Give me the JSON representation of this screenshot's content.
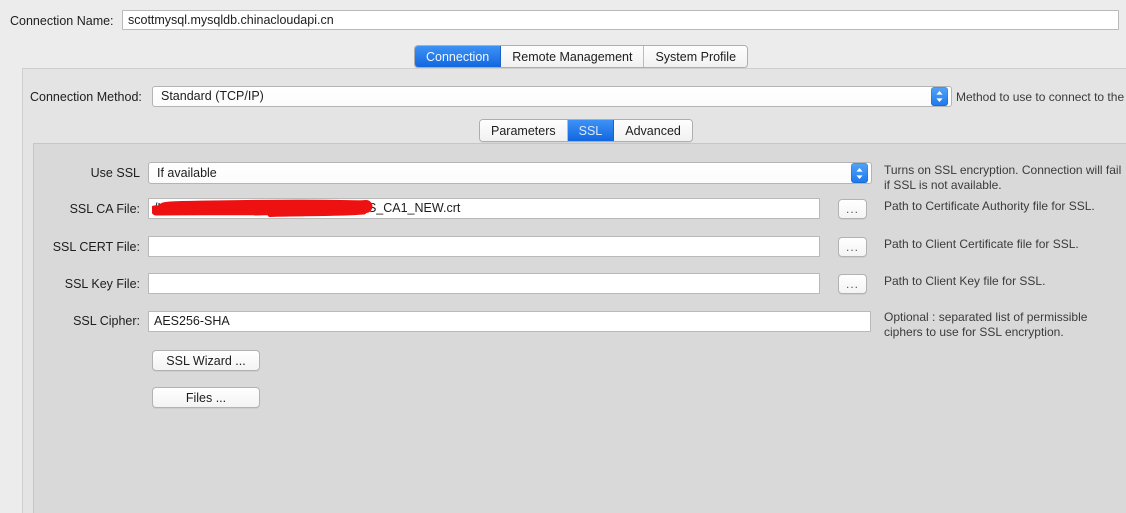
{
  "connection_name": {
    "label": "Connection Name:",
    "value": "scottmysql.mysqldb.chinacloudapi.cn"
  },
  "main_tabs": [
    {
      "label": "Connection",
      "selected": true
    },
    {
      "label": "Remote Management",
      "selected": false
    },
    {
      "label": "System Profile",
      "selected": false
    }
  ],
  "connection_method": {
    "label": "Connection Method:",
    "value": "Standard (TCP/IP)",
    "help": "Method to use to connect to the RD"
  },
  "sub_tabs": [
    {
      "label": "Parameters",
      "selected": false
    },
    {
      "label": "SSL",
      "selected": true
    },
    {
      "label": "Advanced",
      "selected": false
    }
  ],
  "ssl_form": {
    "use_ssl": {
      "label": "Use SSL",
      "value": "If available",
      "help": "Turns on SSL encryption. Connection will fail if SSL is not available."
    },
    "ca_file": {
      "label": "SSL CA File:",
      "value": "/Users/scottxiao/Documents/              /Azure/WS_CA1_NEW.crt",
      "browse_label": "...",
      "help": "Path to Certificate Authority file for SSL."
    },
    "cert_file": {
      "label": "SSL CERT File:",
      "value": "",
      "browse_label": "...",
      "help": "Path to Client Certificate file for SSL."
    },
    "key_file": {
      "label": "SSL Key File:",
      "value": "",
      "browse_label": "...",
      "help": "Path to Client Key file for SSL."
    },
    "cipher": {
      "label": "SSL Cipher:",
      "value": "AES256-SHA",
      "help": "Optional : separated list of permissible ciphers to use for SSL encryption."
    },
    "wizard_button": "SSL Wizard ...",
    "files_button": "Files ..."
  },
  "colors": {
    "accent_blue": "#1267e0",
    "selected_tab_blue": "#3d92f5",
    "window_background": "#ececec",
    "outer_panel": "#e4e4e4",
    "inner_panel": "#d9d9d9",
    "redaction_red": "#ee1111"
  }
}
